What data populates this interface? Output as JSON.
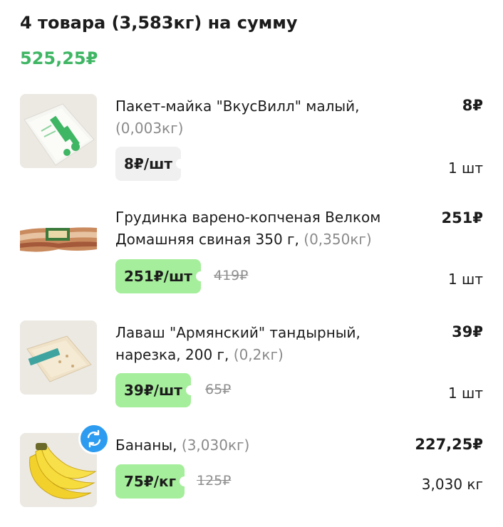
{
  "header": {
    "title": "4 товара (3,583кг) на сумму",
    "total": "525,25₽"
  },
  "items": [
    {
      "name": "Пакет-майка \"ВкусВилл\" малый,",
      "weight": "(0,003кг)",
      "price": "8₽",
      "unit_price": "8₽/шт",
      "old_price": "",
      "quantity": "1 шт",
      "image_icon": "plastic-bag-image"
    },
    {
      "name": "Грудинка варено-копченая Велком Домашняя свиная 350 г,",
      "weight": "(0,350кг)",
      "price": "251₽",
      "unit_price": "251₽/шт",
      "old_price": "419₽",
      "quantity": "1 шт",
      "image_icon": "brisket-image"
    },
    {
      "name": "Лаваш \"Армянский\" тандырный, нарезка, 200 г,",
      "weight": "(0,2кг)",
      "price": "39₽",
      "unit_price": "39₽/шт",
      "old_price": "65₽",
      "quantity": "1 шт",
      "image_icon": "lavash-image"
    },
    {
      "name": "Бананы,",
      "weight": "(3,030кг)",
      "price": "227,25₽",
      "unit_price": "75₽/кг",
      "old_price": "125₽",
      "quantity": "3,030 кг",
      "image_icon": "bananas-image"
    }
  ],
  "colors": {
    "total_green": "#3fb664",
    "discount_tag": "#a5ee9b",
    "regular_tag": "#f0f0f0",
    "swap_badge": "#2d9cf0"
  },
  "icons": {
    "swap": "refresh-icon"
  }
}
